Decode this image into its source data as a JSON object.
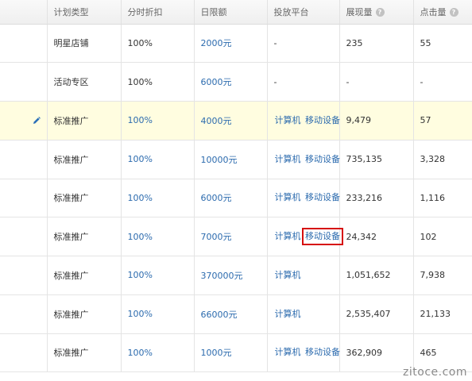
{
  "headers": {
    "type": "计划类型",
    "discount": "分时折扣",
    "budget": "日限额",
    "platform": "投放平台",
    "impressions": "展现量",
    "clicks": "点击量"
  },
  "rows": [
    {
      "type": "明星店铺",
      "discount": "100%",
      "budget": "2000元",
      "pc": "-",
      "mobile": "",
      "impressions": "235",
      "clicks": "55",
      "editable": false,
      "highlight": false
    },
    {
      "type": "活动专区",
      "discount": "100%",
      "budget": "6000元",
      "pc": "-",
      "mobile": "",
      "impressions": "-",
      "clicks": "-",
      "editable": false,
      "highlight": false
    },
    {
      "type": "标准推广",
      "discount": "100%",
      "budget": "4000元",
      "pc": "计算机",
      "mobile": "移动设备",
      "impressions": "9,479",
      "clicks": "57",
      "editable": true,
      "highlight": true
    },
    {
      "type": "标准推广",
      "discount": "100%",
      "budget": "10000元",
      "pc": "计算机",
      "mobile": "移动设备",
      "impressions": "735,135",
      "clicks": "3,328",
      "editable": false,
      "highlight": false
    },
    {
      "type": "标准推广",
      "discount": "100%",
      "budget": "6000元",
      "pc": "计算机",
      "mobile": "移动设备",
      "impressions": "233,216",
      "clicks": "1,116",
      "editable": false,
      "highlight": false
    },
    {
      "type": "标准推广",
      "discount": "100%",
      "budget": "7000元",
      "pc": "计算机",
      "mobile": "移动设备",
      "impressions": "24,342",
      "clicks": "102",
      "editable": false,
      "highlight": false
    },
    {
      "type": "标准推广",
      "discount": "100%",
      "budget": "370000元",
      "pc": "计算机",
      "mobile": "",
      "impressions": "1,051,652",
      "clicks": "7,938",
      "editable": false,
      "highlight": false
    },
    {
      "type": "标准推广",
      "discount": "100%",
      "budget": "66000元",
      "pc": "计算机",
      "mobile": "",
      "impressions": "2,535,407",
      "clicks": "21,133",
      "editable": false,
      "highlight": false
    },
    {
      "type": "标准推广",
      "discount": "100%",
      "budget": "1000元",
      "pc": "计算机",
      "mobile": "移动设备",
      "impressions": "362,909",
      "clicks": "465",
      "editable": false,
      "highlight": false
    }
  ],
  "boxed_row_index": 5,
  "colors": {
    "link": "#2c6bae",
    "highlight_row": "#fffde0",
    "annotation_box": "#d60e0e"
  },
  "icons": {
    "help": "question-circle-icon",
    "edit": "pencil-icon"
  },
  "watermark": "zitoce.com"
}
